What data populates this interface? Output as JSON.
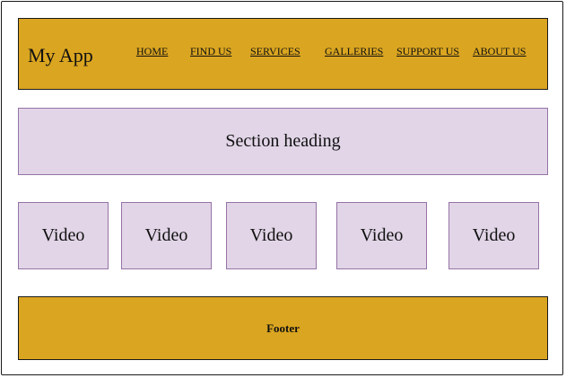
{
  "app": {
    "title": "My App"
  },
  "nav": {
    "items": [
      {
        "label": "HOME"
      },
      {
        "label": "FIND US"
      },
      {
        "label": "SERVICES"
      },
      {
        "label": "GALLERIES"
      },
      {
        "label": "SUPPORT US"
      },
      {
        "label": "ABOUT US"
      }
    ]
  },
  "section": {
    "heading": "Section heading"
  },
  "videos": [
    {
      "label": "Video"
    },
    {
      "label": "Video"
    },
    {
      "label": "Video"
    },
    {
      "label": "Video"
    },
    {
      "label": "Video"
    }
  ],
  "footer": {
    "label": "Footer"
  },
  "colors": {
    "header_bg": "#daa520",
    "panel_bg": "#e1d5e7",
    "panel_border": "#9673a6",
    "outline": "#1a1a1a"
  }
}
